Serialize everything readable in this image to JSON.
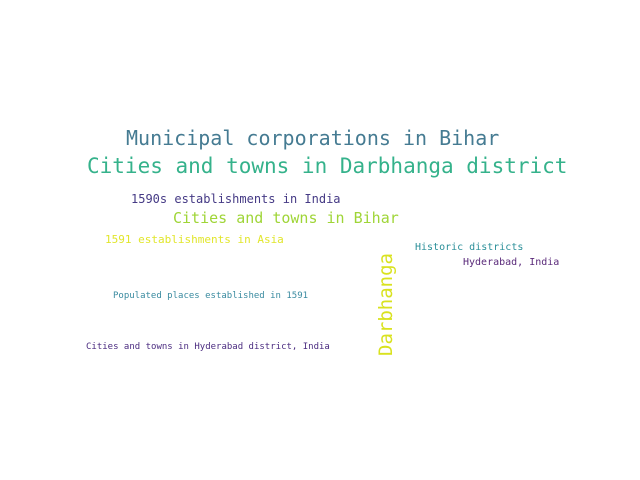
{
  "words": [
    {
      "text": "Municipal corporations in Bihar",
      "color": "#457b92"
    },
    {
      "text": "Cities and towns in Darbhanga district",
      "color": "#35b28b"
    },
    {
      "text": "1590s establishments in India",
      "color": "#453a85"
    },
    {
      "text": "Cities and towns in Bihar",
      "color": "#9fd537"
    },
    {
      "text": "1591 establishments in Asia",
      "color": "#e1e62c"
    },
    {
      "text": "Historic districts",
      "color": "#2b8f99"
    },
    {
      "text": "Hyderabad, India",
      "color": "#5a2a7a"
    },
    {
      "text": "Darbhanga",
      "color": "#d9e21f"
    },
    {
      "text": "Populated places established in 1591",
      "color": "#3a8ba0"
    },
    {
      "text": "Cities and towns in Hyderabad district, India",
      "color": "#4b2c80"
    }
  ]
}
